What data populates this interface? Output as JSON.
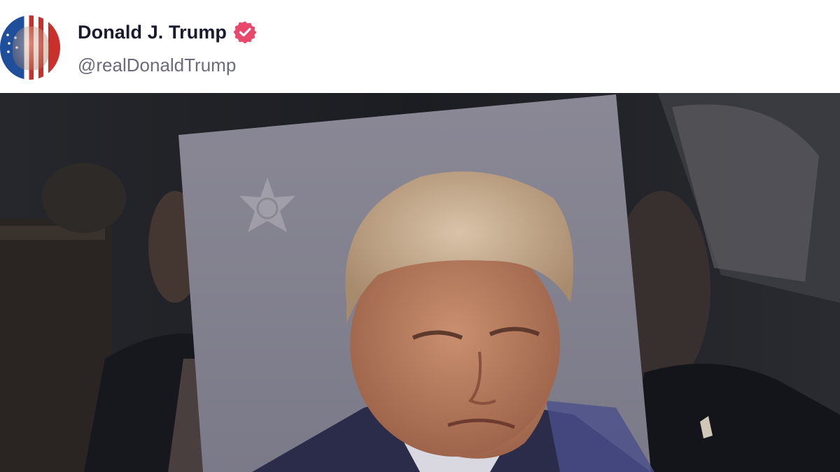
{
  "post": {
    "author": {
      "display_name": "Donald J. Trump",
      "handle": "@realDonaldTrump",
      "verified_icon": "verified-badge-icon",
      "badge_color": "#e9486c",
      "avatar_icon": "avatar-flag-portrait"
    },
    "media": {
      "icon": "embedded-photo",
      "background_color": "#1e1f24"
    }
  }
}
